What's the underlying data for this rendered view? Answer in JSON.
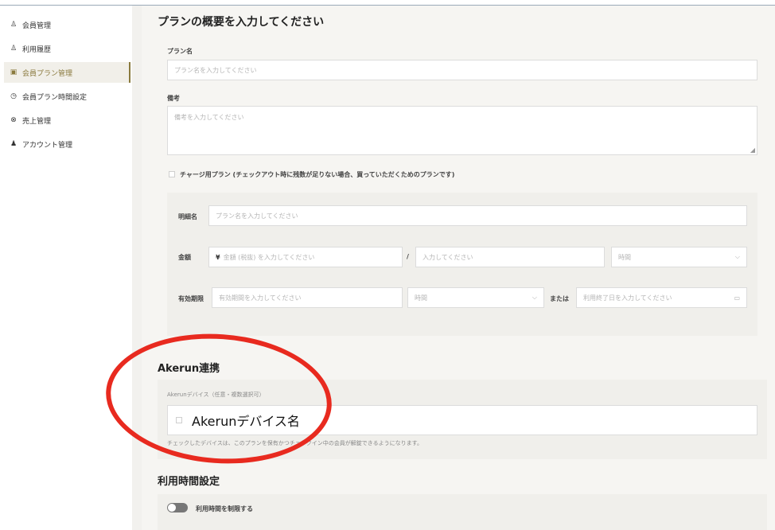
{
  "sidebar": {
    "items": [
      {
        "label": "会員管理",
        "icon": "users-icon",
        "glyph": "♙"
      },
      {
        "label": "利用履歴",
        "icon": "history-icon",
        "glyph": "♙"
      },
      {
        "label": "会員プラン管理",
        "icon": "plan-icon",
        "glyph": "▣"
      },
      {
        "label": "会員プラン時間設定",
        "icon": "clock-icon",
        "glyph": "◷"
      },
      {
        "label": "売上管理",
        "icon": "yen-icon",
        "glyph": "⊗"
      },
      {
        "label": "アカウント管理",
        "icon": "account-icon",
        "glyph": "♟"
      }
    ]
  },
  "form": {
    "title": "プランの概要を入力してください",
    "plan_name_label": "プラン名",
    "plan_name_placeholder": "プラン名を入力してください",
    "remarks_label": "備考",
    "remarks_placeholder": "備考を入力してください",
    "charge_plan_label": "チャージ用プラン (チェックアウト時に残数が足りない場合、買っていただくためのプランです)",
    "detail_name_label": "明細名",
    "detail_name_placeholder": "プラン名を入力してください",
    "amount_label": "金額",
    "amount_prefix": "¥",
    "amount_placeholder": "金額 (税抜) を入力してください",
    "slash": "/",
    "unit_placeholder": "入力してください",
    "unit_select": "時間",
    "validity_label": "有効期限",
    "validity_placeholder": "有効期間を入力してください",
    "validity_select": "時間",
    "or_label": "または",
    "end_date_placeholder": "利用終了日を入力してください"
  },
  "akerun": {
    "title": "Akerun連携",
    "device_label": "Akerunデバイス（任意・複数選択可）",
    "device_item": "Akerunデバイス名",
    "note": "チェックしたデバイスは、このプランを保有かつチェックイン中の会員が解錠できるようになります。"
  },
  "usage": {
    "title": "利用時間設定",
    "toggle_label": "利用時間を制限する"
  },
  "colors": {
    "accent": "#8a7a3e",
    "annotation": "#e82a1f"
  }
}
